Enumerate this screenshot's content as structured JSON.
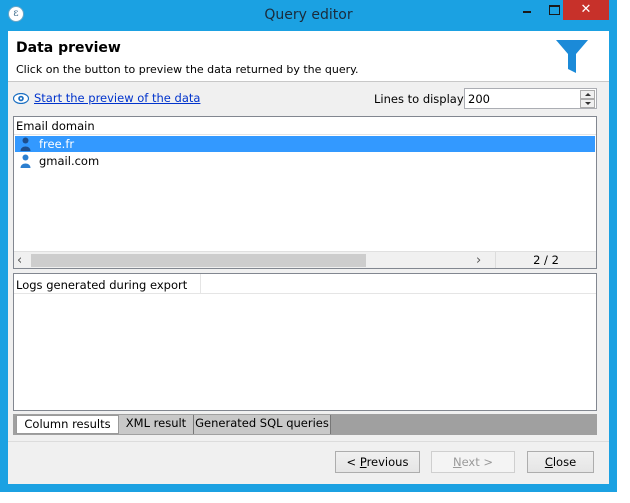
{
  "window": {
    "title": "Query editor",
    "icon": "app-icon",
    "close_glyph": "✕"
  },
  "header": {
    "title": "Data preview",
    "subtitle": "Click on the button to preview the data returned by the query."
  },
  "preview": {
    "link_label": "Start the preview of the data",
    "lines_label": "Lines to display:",
    "lines_value": "200"
  },
  "results": {
    "column_header": "Email domain",
    "rows": [
      {
        "label": "free.fr",
        "selected": true
      },
      {
        "label": "gmail.com",
        "selected": false
      }
    ],
    "count": "2 / 2"
  },
  "logs": {
    "header": "Logs generated during export"
  },
  "tabs": [
    {
      "label": "Column results",
      "active": true
    },
    {
      "label": "XML result",
      "active": false
    },
    {
      "label": "Generated SQL queries",
      "active": false
    }
  ],
  "buttons": {
    "previous_prefix": "< ",
    "previous_mnemonic": "P",
    "previous_rest": "revious",
    "next_mnemonic": "N",
    "next_rest": "ext >",
    "close_mnemonic": "C",
    "close_rest": "lose"
  },
  "colors": {
    "titlebar": "#1ba1e2",
    "selection": "#3399ff",
    "close_button": "#c7312a",
    "funnel": "#1b8ad8"
  }
}
